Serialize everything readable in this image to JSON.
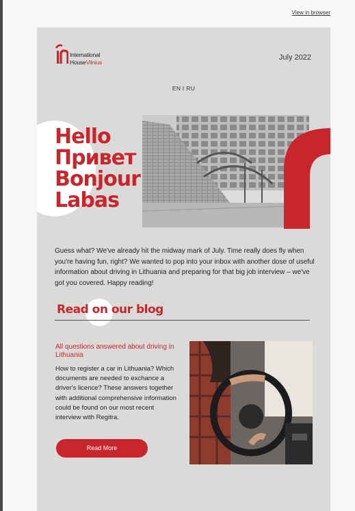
{
  "header": {
    "view_in_browser": "View in browser"
  },
  "logo": {
    "line1": "International",
    "line2a": "House",
    "line2b": "Vilnius"
  },
  "date": "July 2022",
  "language_switch": "EN I RU",
  "hero": {
    "greetings": [
      "Hello",
      "Привет",
      "Bonjour",
      "Labas"
    ]
  },
  "intro": "Guess what? We've already hit the midway mark of July. Time really does fly when you're having fun, right? We wanted to pop into your inbox with another dose of useful information about driving in Lithuania and preparing for that big job interview – we've got you covered. Happy reading!",
  "blog": {
    "section_title": "Read on our blog",
    "article": {
      "title": "All questions answered about driving in Lithuania",
      "body": "How to register a car in Lithuania? Which documents are needed to exchance a driver's licence? These answers together with additional comprehensive information could be found on our most recent interview with Regitra.",
      "button_label": "Read More"
    }
  },
  "colors": {
    "brand_red": "#c8252c",
    "card_bg": "#dcdad9",
    "page_bg": "#f7f7f8"
  }
}
